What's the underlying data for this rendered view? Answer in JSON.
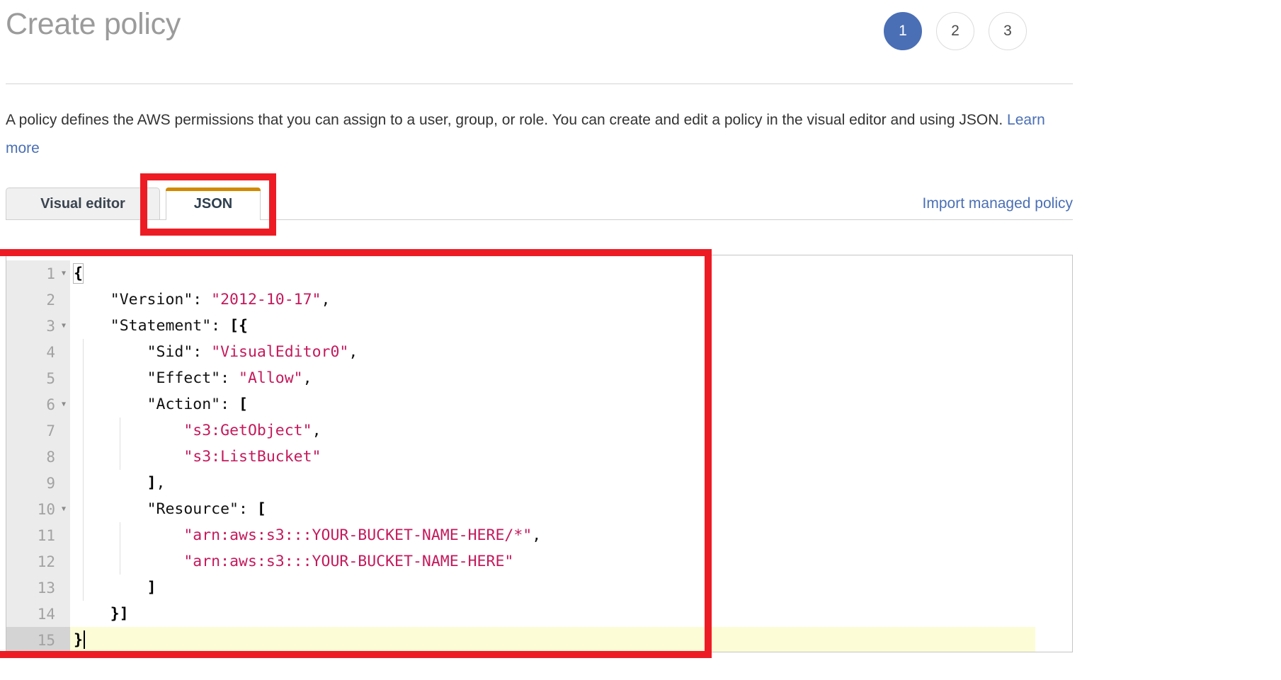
{
  "header": {
    "title": "Create policy",
    "steps": [
      {
        "label": "1",
        "state": "active"
      },
      {
        "label": "2",
        "state": "inactive"
      },
      {
        "label": "3",
        "state": "inactive"
      }
    ]
  },
  "description": {
    "text_before_link": "A policy defines the AWS permissions that you can assign to a user, group, or role. You can create and edit a policy in the visual editor and using JSON. ",
    "link_label": "Learn more"
  },
  "tabs": {
    "items": [
      {
        "label": "Visual editor",
        "active": false
      },
      {
        "label": "JSON",
        "active": true
      }
    ],
    "import_link_label": "Import managed policy",
    "active_tab_accent": "#d08a00"
  },
  "editor": {
    "active_line": 15,
    "active_line_highlight_color": "#fcfcd7",
    "string_color": "#c41a5b",
    "key_color": "#111111",
    "gutter_color": "#ebebeb",
    "lines": [
      {
        "n": "1",
        "fold": true,
        "indent": 0,
        "text": "{"
      },
      {
        "n": "2",
        "fold": false,
        "indent": 0,
        "text": "    \"Version\": \"2012-10-17\","
      },
      {
        "n": "3",
        "fold": true,
        "indent": 0,
        "text": "    \"Statement\": [{"
      },
      {
        "n": "4",
        "fold": false,
        "indent": 1,
        "text": "        \"Sid\": \"VisualEditor0\","
      },
      {
        "n": "5",
        "fold": false,
        "indent": 1,
        "text": "        \"Effect\": \"Allow\","
      },
      {
        "n": "6",
        "fold": true,
        "indent": 1,
        "text": "        \"Action\": ["
      },
      {
        "n": "7",
        "fold": false,
        "indent": 2,
        "text": "            \"s3:GetObject\","
      },
      {
        "n": "8",
        "fold": false,
        "indent": 2,
        "text": "            \"s3:ListBucket\""
      },
      {
        "n": "9",
        "fold": false,
        "indent": 1,
        "text": "        ],"
      },
      {
        "n": "10",
        "fold": true,
        "indent": 1,
        "text": "        \"Resource\": ["
      },
      {
        "n": "11",
        "fold": false,
        "indent": 2,
        "text": "            \"arn:aws:s3:::YOUR-BUCKET-NAME-HERE/*\","
      },
      {
        "n": "12",
        "fold": false,
        "indent": 2,
        "text": "            \"arn:aws:s3:::YOUR-BUCKET-NAME-HERE\""
      },
      {
        "n": "13",
        "fold": false,
        "indent": 1,
        "text": "        ]"
      },
      {
        "n": "14",
        "fold": false,
        "indent": 0,
        "text": "    }]"
      },
      {
        "n": "15",
        "fold": false,
        "indent": 0,
        "text": "}"
      }
    ],
    "policy_json": {
      "Version": "2012-10-17",
      "Statement": [
        {
          "Sid": "VisualEditor0",
          "Effect": "Allow",
          "Action": [
            "s3:GetObject",
            "s3:ListBucket"
          ],
          "Resource": [
            "arn:aws:s3:::YOUR-BUCKET-NAME-HERE/*",
            "arn:aws:s3:::YOUR-BUCKET-NAME-HERE"
          ]
        }
      ]
    }
  },
  "annotations": {
    "color": "#ed1c24",
    "boxes": [
      {
        "name": "json-tab-highlight"
      },
      {
        "name": "editor-highlight"
      }
    ]
  }
}
